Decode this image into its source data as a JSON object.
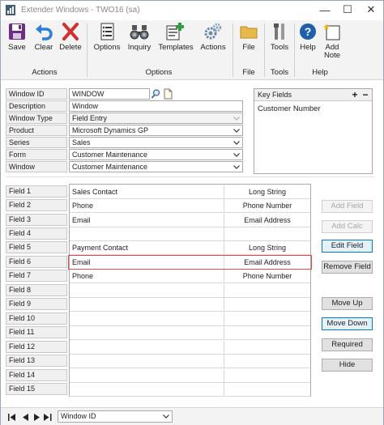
{
  "window": {
    "title": "Extender Windows  -  TWO16 (sa)",
    "minimize_glyph": "—",
    "maximize_glyph": "☐",
    "close_glyph": "✕"
  },
  "ribbon": {
    "buttons": {
      "save": "Save",
      "clear": "Clear",
      "delete": "Delete",
      "options": "Options",
      "inquiry": "Inquiry",
      "templates": "Templates",
      "actions": "Actions",
      "file": "File",
      "tools": "Tools",
      "help": "Help",
      "add_note_1": "Add",
      "add_note_2": "Note"
    },
    "groups": {
      "actions": "Actions",
      "options": "Options",
      "file": "File",
      "tools": "Tools",
      "help": "Help"
    },
    "icons": [
      "save-icon",
      "undo-icon",
      "delete-x-icon",
      "options-list-icon",
      "inquiry-binoculars-icon",
      "templates-icon",
      "actions-gears-icon",
      "file-folder-icon",
      "tools-icon",
      "help-icon",
      "add-note-icon"
    ]
  },
  "header": {
    "labels": {
      "window_id": "Window ID",
      "description": "Description",
      "window_type": "Window Type",
      "product": "Product",
      "series": "Series",
      "form": "Form",
      "window": "Window"
    },
    "values": {
      "window_id": "WINDOW",
      "description": "Window",
      "window_type": "Field Entry",
      "product": "Microsoft Dynamics GP",
      "series": "Sales",
      "form": "Customer Maintenance",
      "window": "Customer Maintenance"
    }
  },
  "key_fields": {
    "title": "Key Fields",
    "add_glyph": "+",
    "remove_glyph": "−",
    "items": [
      "Customer Number"
    ]
  },
  "fields": {
    "rows": [
      {
        "label": "Field 1",
        "name": "Sales Contact",
        "type": "Long String"
      },
      {
        "label": "Field 2",
        "name": "Phone",
        "type": "Phone Number"
      },
      {
        "label": "Field 3",
        "name": "Email",
        "type": "Email Address"
      },
      {
        "label": "Field 4",
        "name": "",
        "type": ""
      },
      {
        "label": "Field 5",
        "name": "Payment Contact",
        "type": "Long String"
      },
      {
        "label": "Field 6",
        "name": "Email",
        "type": "Email Address"
      },
      {
        "label": "Field 7",
        "name": "Phone",
        "type": "Phone Number"
      },
      {
        "label": "Field 8",
        "name": "",
        "type": ""
      },
      {
        "label": "Field 9",
        "name": "",
        "type": ""
      },
      {
        "label": "Field 10",
        "name": "",
        "type": ""
      },
      {
        "label": "Field 11",
        "name": "",
        "type": ""
      },
      {
        "label": "Field 12",
        "name": "",
        "type": ""
      },
      {
        "label": "Field 13",
        "name": "",
        "type": ""
      },
      {
        "label": "Field 14",
        "name": "",
        "type": ""
      },
      {
        "label": "Field 15",
        "name": "",
        "type": ""
      }
    ],
    "selected_index": 5
  },
  "side_buttons": {
    "add_field": "Add Field",
    "add_calc": "Add Calc",
    "edit_field": "Edit Field",
    "remove_field": "Remove Field",
    "move_up": "Move Up",
    "move_down": "Move Down",
    "required": "Required",
    "hide": "Hide"
  },
  "statusbar": {
    "sort_by": "Window ID"
  },
  "colors": {
    "accent": "#0078d7",
    "selection_border": "#e04b4b",
    "ribbon_bg": "#f3f3f3"
  }
}
